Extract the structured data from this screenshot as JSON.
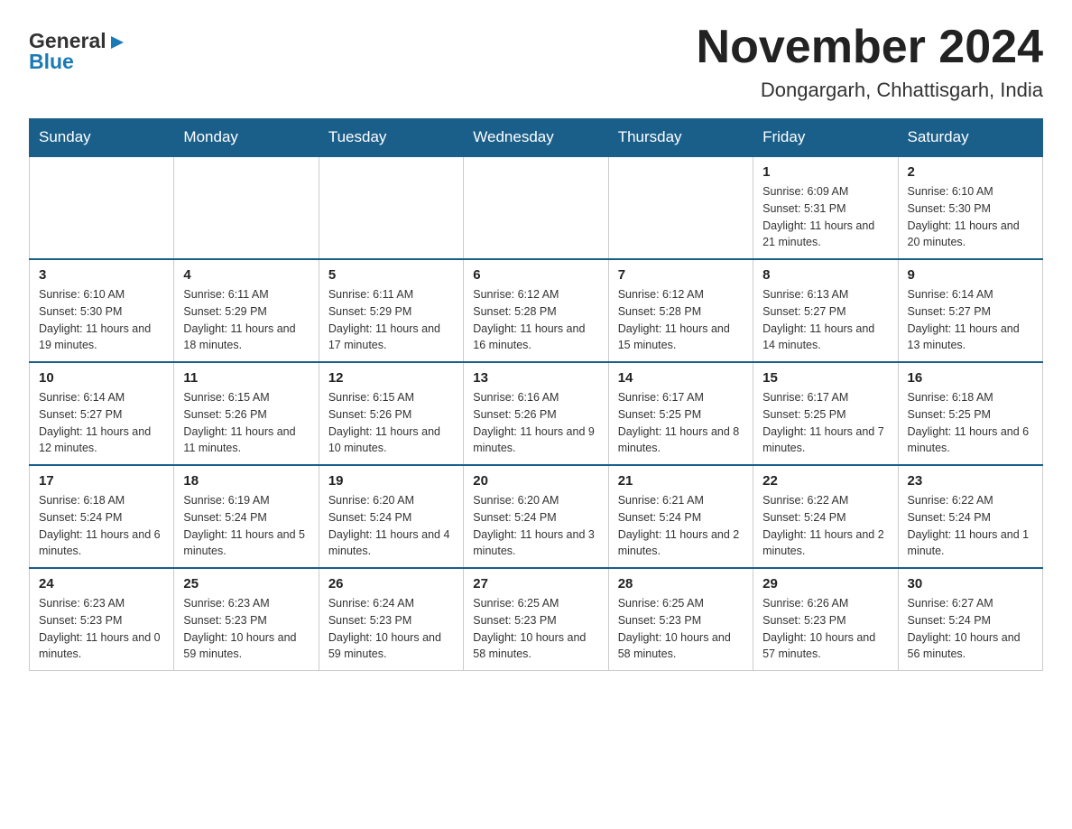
{
  "header": {
    "logo_general": "General",
    "logo_blue": "Blue",
    "title": "November 2024",
    "subtitle": "Dongargarh, Chhattisgarh, India"
  },
  "calendar": {
    "days_of_week": [
      "Sunday",
      "Monday",
      "Tuesday",
      "Wednesday",
      "Thursday",
      "Friday",
      "Saturday"
    ],
    "weeks": [
      [
        {
          "day": "",
          "info": ""
        },
        {
          "day": "",
          "info": ""
        },
        {
          "day": "",
          "info": ""
        },
        {
          "day": "",
          "info": ""
        },
        {
          "day": "",
          "info": ""
        },
        {
          "day": "1",
          "info": "Sunrise: 6:09 AM\nSunset: 5:31 PM\nDaylight: 11 hours and 21 minutes."
        },
        {
          "day": "2",
          "info": "Sunrise: 6:10 AM\nSunset: 5:30 PM\nDaylight: 11 hours and 20 minutes."
        }
      ],
      [
        {
          "day": "3",
          "info": "Sunrise: 6:10 AM\nSunset: 5:30 PM\nDaylight: 11 hours and 19 minutes."
        },
        {
          "day": "4",
          "info": "Sunrise: 6:11 AM\nSunset: 5:29 PM\nDaylight: 11 hours and 18 minutes."
        },
        {
          "day": "5",
          "info": "Sunrise: 6:11 AM\nSunset: 5:29 PM\nDaylight: 11 hours and 17 minutes."
        },
        {
          "day": "6",
          "info": "Sunrise: 6:12 AM\nSunset: 5:28 PM\nDaylight: 11 hours and 16 minutes."
        },
        {
          "day": "7",
          "info": "Sunrise: 6:12 AM\nSunset: 5:28 PM\nDaylight: 11 hours and 15 minutes."
        },
        {
          "day": "8",
          "info": "Sunrise: 6:13 AM\nSunset: 5:27 PM\nDaylight: 11 hours and 14 minutes."
        },
        {
          "day": "9",
          "info": "Sunrise: 6:14 AM\nSunset: 5:27 PM\nDaylight: 11 hours and 13 minutes."
        }
      ],
      [
        {
          "day": "10",
          "info": "Sunrise: 6:14 AM\nSunset: 5:27 PM\nDaylight: 11 hours and 12 minutes."
        },
        {
          "day": "11",
          "info": "Sunrise: 6:15 AM\nSunset: 5:26 PM\nDaylight: 11 hours and 11 minutes."
        },
        {
          "day": "12",
          "info": "Sunrise: 6:15 AM\nSunset: 5:26 PM\nDaylight: 11 hours and 10 minutes."
        },
        {
          "day": "13",
          "info": "Sunrise: 6:16 AM\nSunset: 5:26 PM\nDaylight: 11 hours and 9 minutes."
        },
        {
          "day": "14",
          "info": "Sunrise: 6:17 AM\nSunset: 5:25 PM\nDaylight: 11 hours and 8 minutes."
        },
        {
          "day": "15",
          "info": "Sunrise: 6:17 AM\nSunset: 5:25 PM\nDaylight: 11 hours and 7 minutes."
        },
        {
          "day": "16",
          "info": "Sunrise: 6:18 AM\nSunset: 5:25 PM\nDaylight: 11 hours and 6 minutes."
        }
      ],
      [
        {
          "day": "17",
          "info": "Sunrise: 6:18 AM\nSunset: 5:24 PM\nDaylight: 11 hours and 6 minutes."
        },
        {
          "day": "18",
          "info": "Sunrise: 6:19 AM\nSunset: 5:24 PM\nDaylight: 11 hours and 5 minutes."
        },
        {
          "day": "19",
          "info": "Sunrise: 6:20 AM\nSunset: 5:24 PM\nDaylight: 11 hours and 4 minutes."
        },
        {
          "day": "20",
          "info": "Sunrise: 6:20 AM\nSunset: 5:24 PM\nDaylight: 11 hours and 3 minutes."
        },
        {
          "day": "21",
          "info": "Sunrise: 6:21 AM\nSunset: 5:24 PM\nDaylight: 11 hours and 2 minutes."
        },
        {
          "day": "22",
          "info": "Sunrise: 6:22 AM\nSunset: 5:24 PM\nDaylight: 11 hours and 2 minutes."
        },
        {
          "day": "23",
          "info": "Sunrise: 6:22 AM\nSunset: 5:24 PM\nDaylight: 11 hours and 1 minute."
        }
      ],
      [
        {
          "day": "24",
          "info": "Sunrise: 6:23 AM\nSunset: 5:23 PM\nDaylight: 11 hours and 0 minutes."
        },
        {
          "day": "25",
          "info": "Sunrise: 6:23 AM\nSunset: 5:23 PM\nDaylight: 10 hours and 59 minutes."
        },
        {
          "day": "26",
          "info": "Sunrise: 6:24 AM\nSunset: 5:23 PM\nDaylight: 10 hours and 59 minutes."
        },
        {
          "day": "27",
          "info": "Sunrise: 6:25 AM\nSunset: 5:23 PM\nDaylight: 10 hours and 58 minutes."
        },
        {
          "day": "28",
          "info": "Sunrise: 6:25 AM\nSunset: 5:23 PM\nDaylight: 10 hours and 58 minutes."
        },
        {
          "day": "29",
          "info": "Sunrise: 6:26 AM\nSunset: 5:23 PM\nDaylight: 10 hours and 57 minutes."
        },
        {
          "day": "30",
          "info": "Sunrise: 6:27 AM\nSunset: 5:24 PM\nDaylight: 10 hours and 56 minutes."
        }
      ]
    ]
  }
}
